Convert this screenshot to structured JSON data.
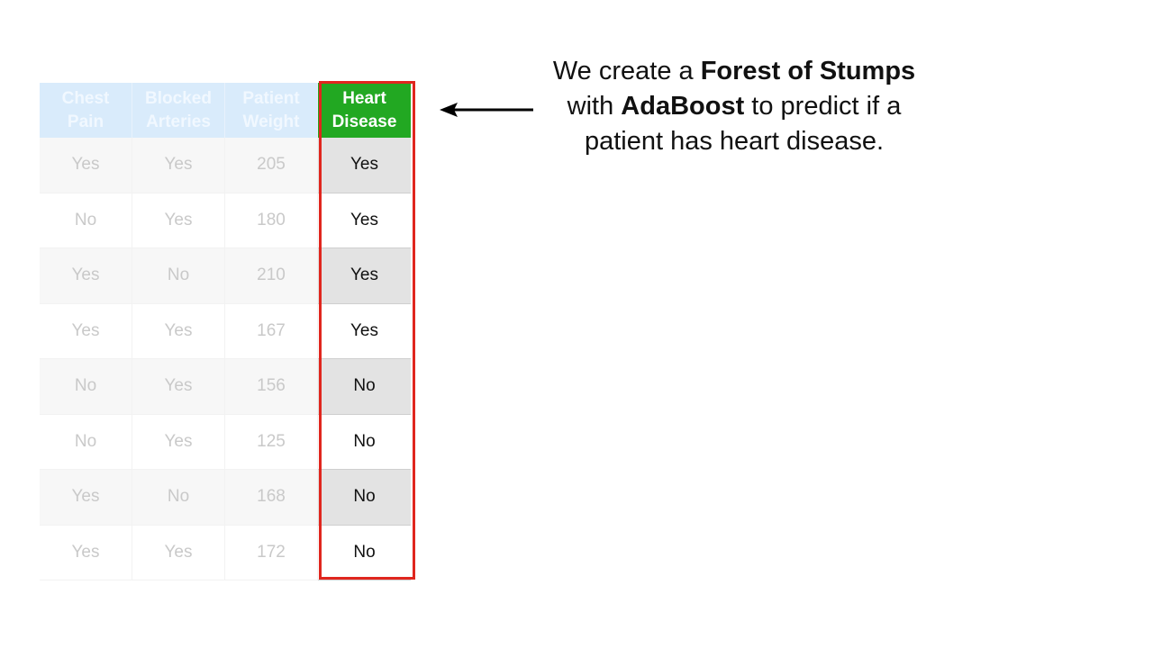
{
  "caption": {
    "line1_pre": "We create a ",
    "line1_bold": "Forest of Stumps",
    "line2_pre": "with ",
    "line2_bold": "AdaBoost",
    "line2_post": " to predict if a",
    "line3": "patient has heart disease."
  },
  "table": {
    "headers": {
      "chest_pain": [
        "Chest",
        "Pain"
      ],
      "blocked_arteries": [
        "Blocked",
        "Arteries"
      ],
      "patient_weight": [
        "Patient",
        "Weight"
      ],
      "heart_disease": [
        "Heart",
        "Disease"
      ]
    },
    "rows": [
      [
        "Yes",
        "Yes",
        "205",
        "Yes"
      ],
      [
        "No",
        "Yes",
        "180",
        "Yes"
      ],
      [
        "Yes",
        "No",
        "210",
        "Yes"
      ],
      [
        "Yes",
        "Yes",
        "167",
        "Yes"
      ],
      [
        "No",
        "Yes",
        "156",
        "No"
      ],
      [
        "No",
        "Yes",
        "125",
        "No"
      ],
      [
        "Yes",
        "No",
        "168",
        "No"
      ],
      [
        "Yes",
        "Yes",
        "172",
        "No"
      ]
    ]
  },
  "colors": {
    "target_header": "#22a822",
    "highlight_border": "#e0261e",
    "faded_header": "#d9ebfb",
    "arrow": "#000000"
  },
  "icons": {
    "pointer": "left-arrow-icon"
  }
}
